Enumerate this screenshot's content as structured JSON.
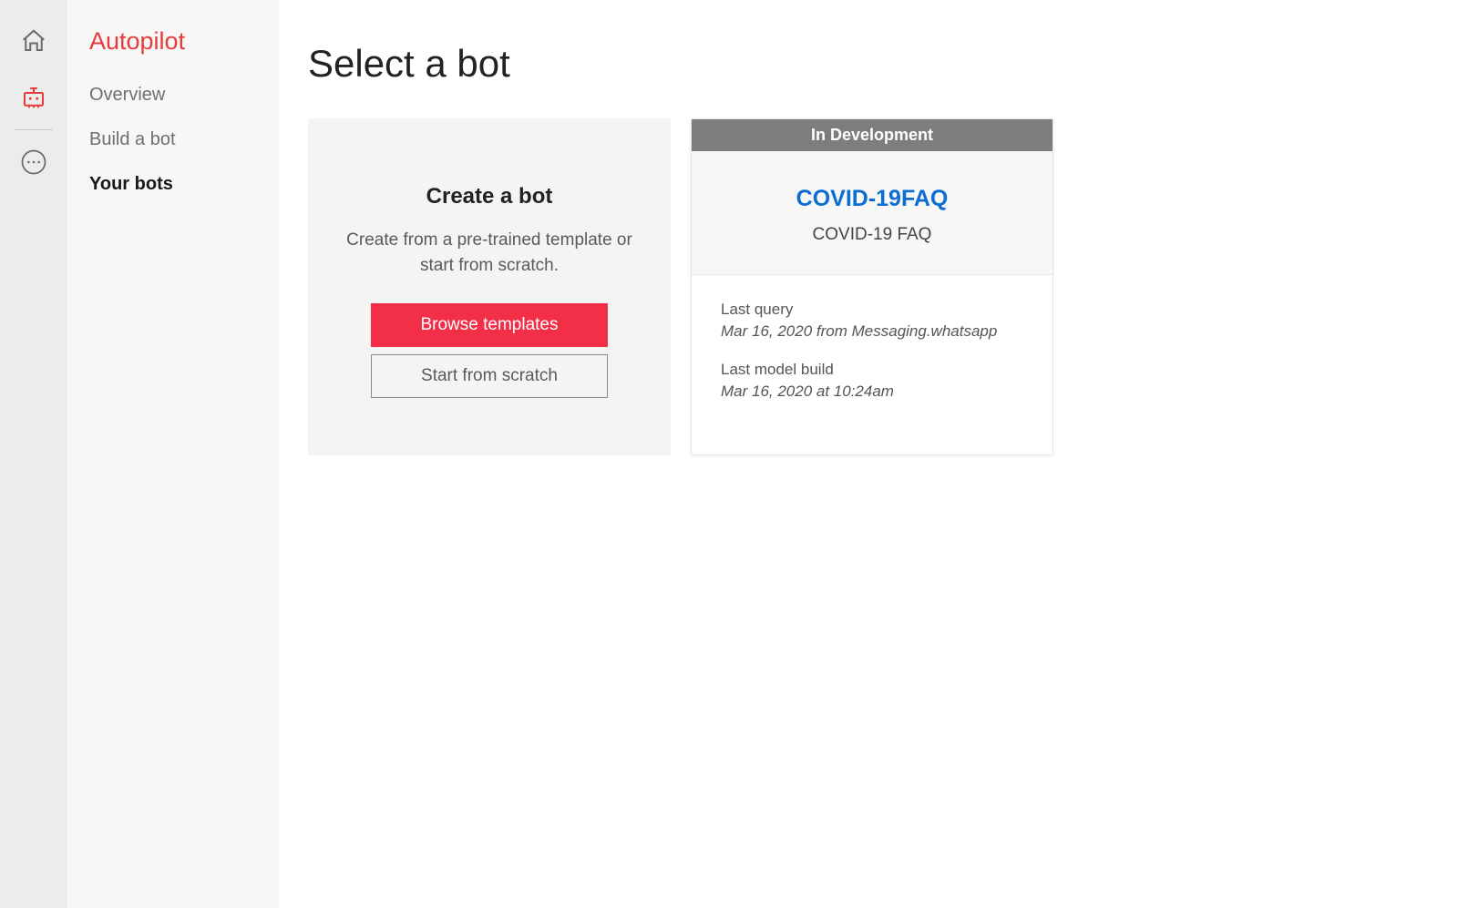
{
  "sidebar": {
    "section_title": "Autopilot",
    "items": [
      {
        "label": "Overview"
      },
      {
        "label": "Build a bot"
      },
      {
        "label": "Your bots"
      }
    ],
    "active_index": 2
  },
  "main": {
    "title": "Select a bot",
    "create_card": {
      "title": "Create a bot",
      "subtitle": "Create from a pre-trained template or start from scratch.",
      "primary_button": "Browse templates",
      "secondary_button": "Start from scratch"
    },
    "bots": [
      {
        "status": "In Development",
        "name": "COVID-19FAQ",
        "description": "COVID-19 FAQ",
        "last_query_label": "Last query",
        "last_query_value": "Mar 16, 2020 from Messaging.whatsapp",
        "last_build_label": "Last model build",
        "last_build_value": "Mar 16, 2020 at 10:24am"
      }
    ]
  },
  "colors": {
    "accent": "#f22f46",
    "link": "#0d6ed1"
  }
}
